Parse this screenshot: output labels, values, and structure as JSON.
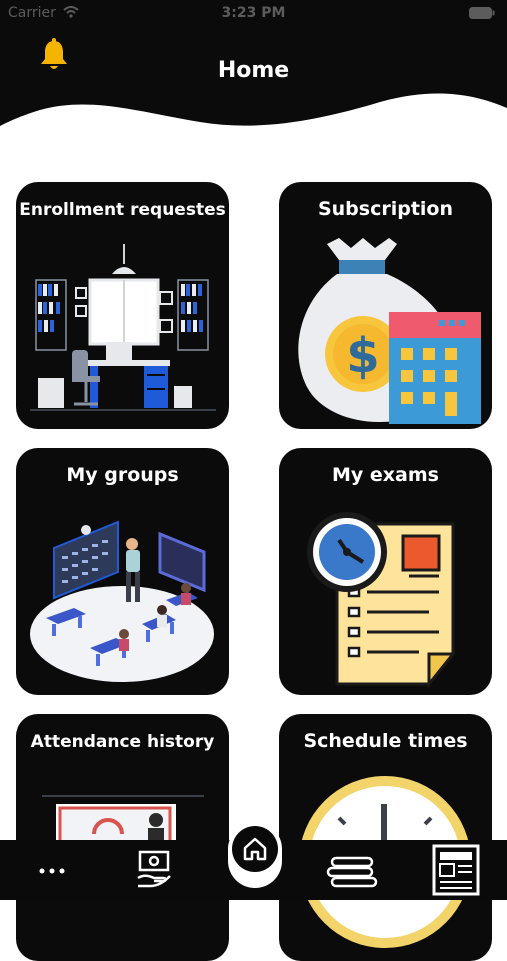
{
  "status_bar": {
    "carrier": "Carrier",
    "time": "3:23 PM"
  },
  "header": {
    "title": "Home",
    "bell_icon": "bell-icon"
  },
  "cards": [
    {
      "label": "Enrollment requestes",
      "icon": "office-room-illustration"
    },
    {
      "label": "Subscription",
      "icon": "money-bag-calendar-illustration"
    },
    {
      "label": "My groups",
      "icon": "classroom-illustration"
    },
    {
      "label": "My exams",
      "icon": "exam-paper-clock-illustration"
    },
    {
      "label": "Attendance history",
      "icon": "attendance-illustration"
    },
    {
      "label": "Schedule times",
      "icon": "clock-illustration"
    }
  ],
  "bottom_nav": [
    {
      "icon": "more-dots-icon"
    },
    {
      "icon": "money-hand-icon"
    },
    {
      "icon": "home-icon"
    },
    {
      "icon": "books-stack-icon"
    },
    {
      "icon": "newspaper-icon"
    }
  ],
  "colors": {
    "header_bg": "#0b0b0b",
    "card_bg": "#0b0b0b",
    "bell": "#f4b400",
    "accent_blue": "#1f5bd8",
    "accent_yellow": "#f7c63d"
  }
}
